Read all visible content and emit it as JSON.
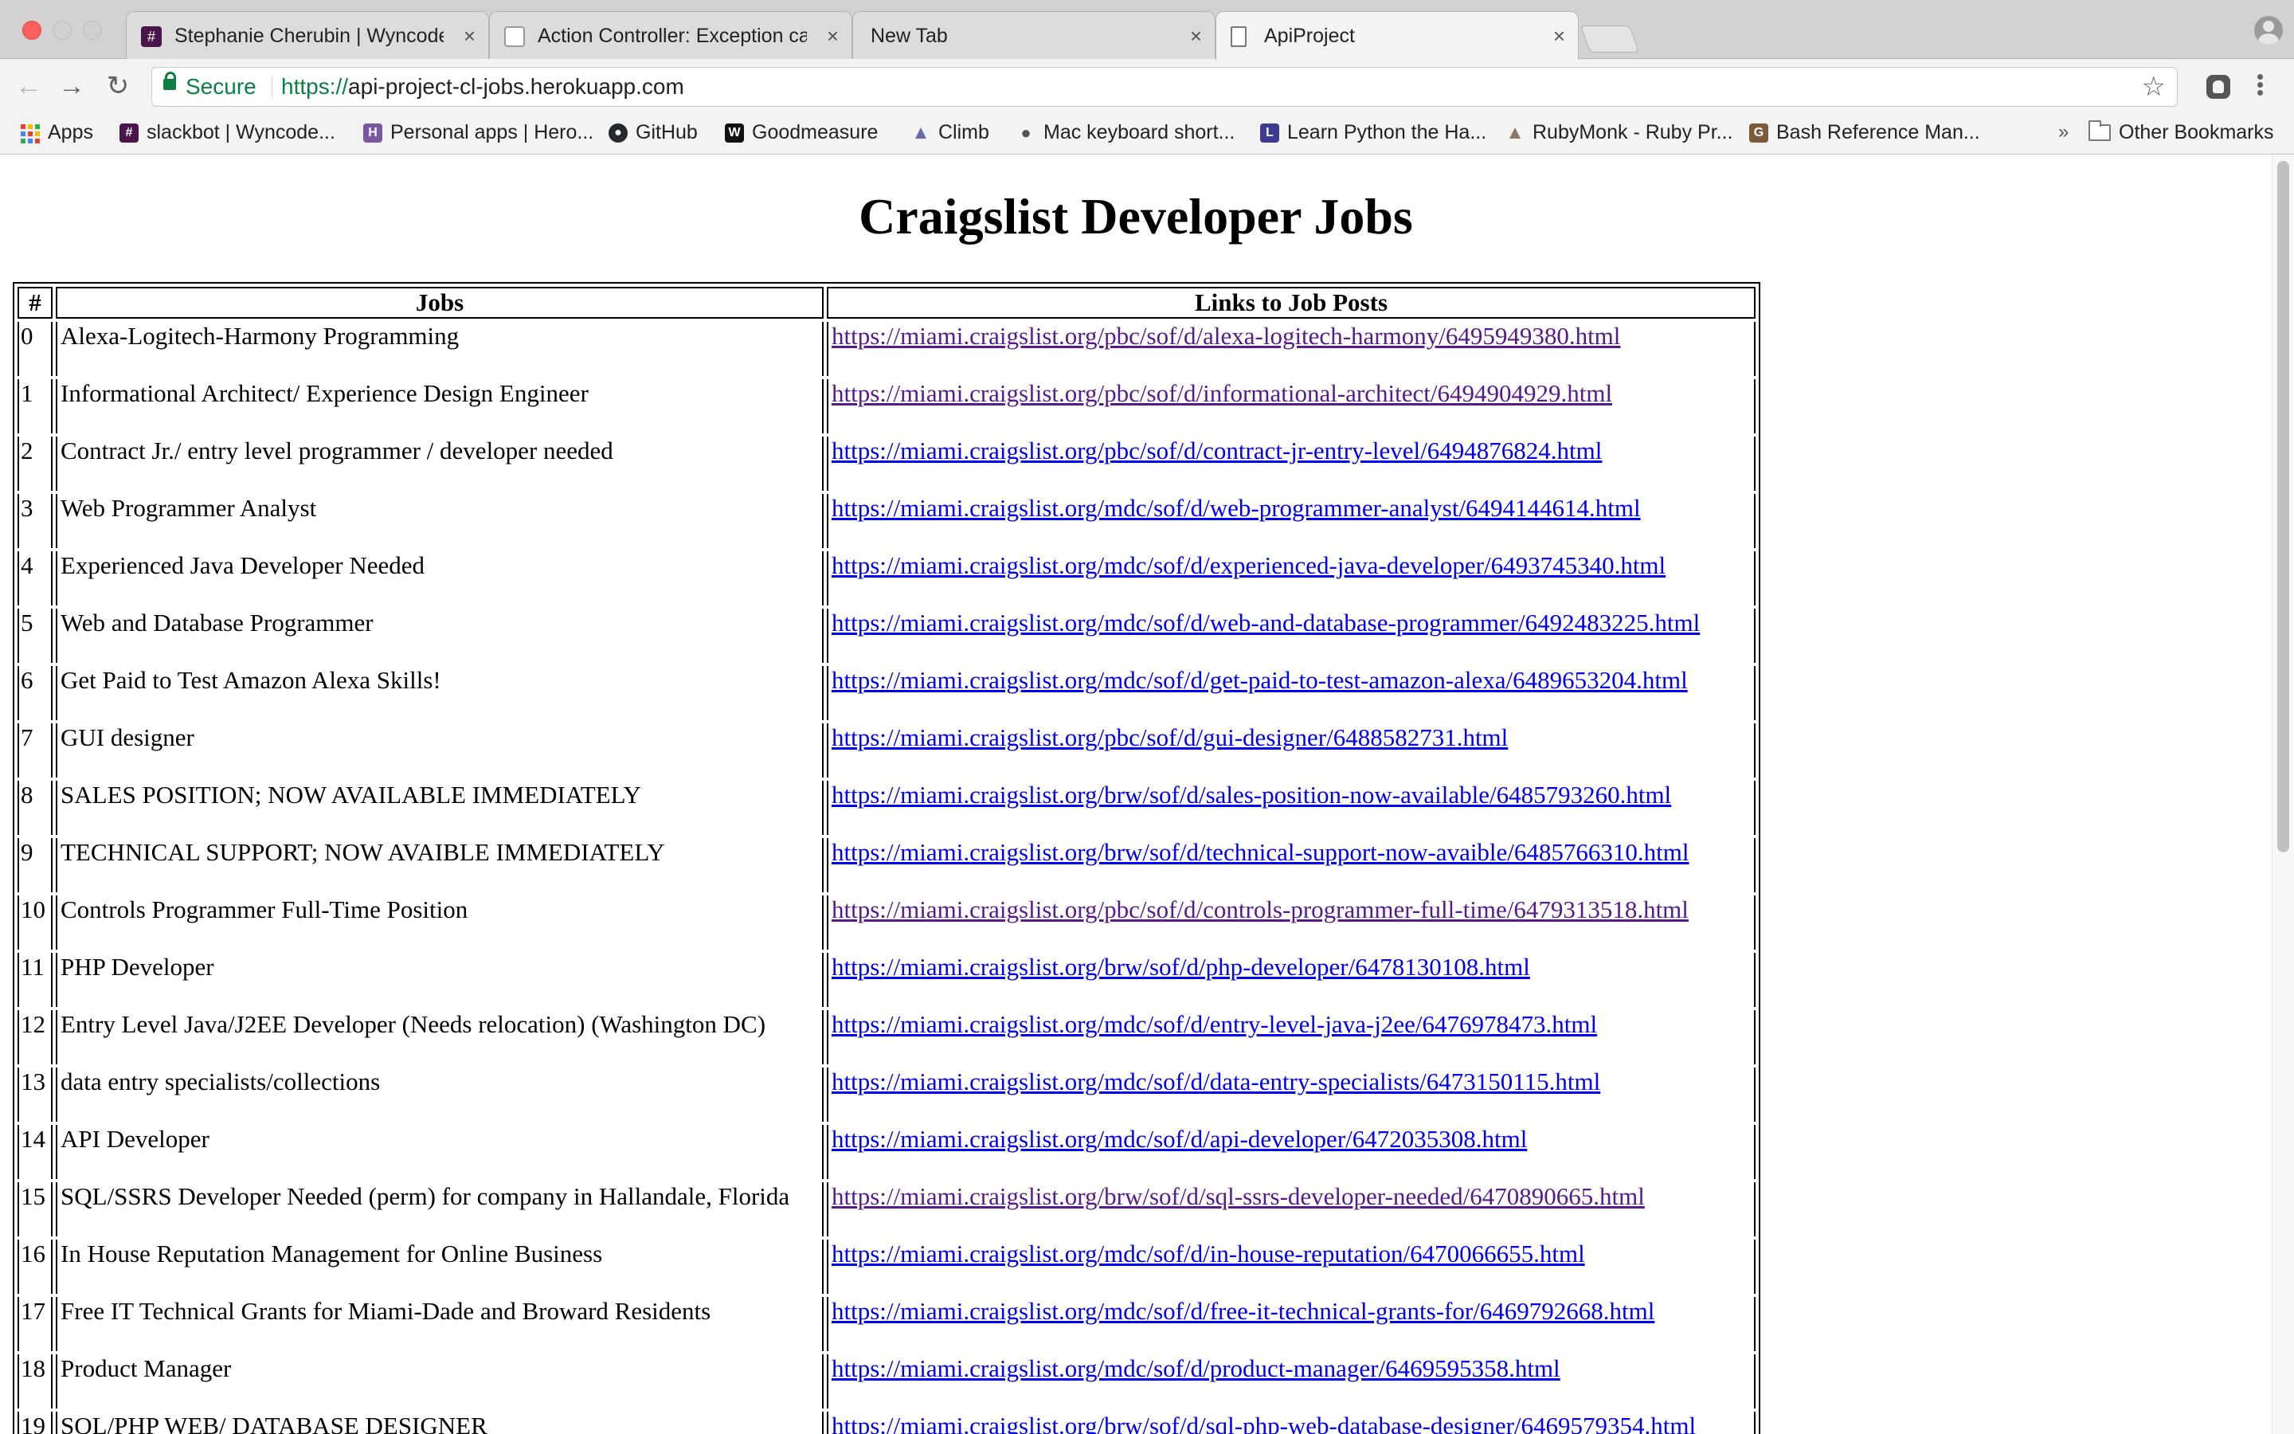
{
  "window": {
    "tabs": [
      {
        "title": "Stephanie Cherubin | Wyncode",
        "favicon_icon": "slack-hash-icon",
        "favicon_color": "#4a154b"
      },
      {
        "title": "Action Controller: Exception ca",
        "favicon_icon": "rails-page-icon",
        "favicon_color": "#9a9a9a"
      },
      {
        "title": "New Tab",
        "favicon_icon": "",
        "favicon_color": ""
      },
      {
        "title": "ApiProject",
        "favicon_icon": "document-icon",
        "favicon_color": "#777777"
      }
    ],
    "active_tab_index": 3,
    "close_glyph": "×"
  },
  "toolbar": {
    "back_glyph": "←",
    "forward_glyph": "→",
    "reload_glyph": "↻",
    "secure_label": "Secure",
    "url_scheme": "https://",
    "url_rest": "api-project-cl-jobs.herokuapp.com",
    "star_glyph": "☆"
  },
  "bookmarks": {
    "items": [
      {
        "label": "Apps",
        "icon": "apps-grid-icon"
      },
      {
        "label": "slackbot | Wyncode...",
        "icon": "slack-hash-icon",
        "color": "#4a154b",
        "glyph": "#"
      },
      {
        "label": "Personal apps | Hero...",
        "icon": "heroku-icon",
        "color": "#79589f",
        "glyph": "H"
      },
      {
        "label": "GitHub",
        "icon": "github-icon",
        "color": "#24292e",
        "glyph": "●"
      },
      {
        "label": "Goodmeasure",
        "icon": "goodmeasure-icon",
        "color": "#111111",
        "glyph": "W"
      },
      {
        "label": "Climb",
        "icon": "climb-mountain-icon",
        "color": "#6b6baa",
        "glyph": "▲"
      },
      {
        "label": "Mac keyboard short...",
        "icon": "apple-icon",
        "color": "#555555",
        "glyph": "●"
      },
      {
        "label": "Learn Python the Ha...",
        "icon": "python-book-icon",
        "color": "#3b3b8f",
        "glyph": "L"
      },
      {
        "label": "RubyMonk - Ruby Pr...",
        "icon": "rubymonk-icon",
        "color": "#8a7b66",
        "glyph": "▲"
      },
      {
        "label": "Bash Reference Man...",
        "icon": "gnu-icon",
        "color": "#7a5c3a",
        "glyph": "G"
      }
    ],
    "overflow_glyph": "»",
    "other_bookmarks_label": "Other Bookmarks"
  },
  "page": {
    "heading": "Craigslist Developer Jobs",
    "table": {
      "headers": [
        "#",
        "Jobs",
        "Links to Job Posts"
      ],
      "rows": [
        {
          "idx": "0",
          "job": "Alexa-Logitech-Harmony Programming",
          "link": "https://miami.craigslist.org/pbc/sof/d/alexa-logitech-harmony/6495949380.html",
          "visited": true
        },
        {
          "idx": "1",
          "job": "Informational Architect/ Experience Design Engineer",
          "link": "https://miami.craigslist.org/pbc/sof/d/informational-architect/6494904929.html",
          "visited": true
        },
        {
          "idx": "2",
          "job": "Contract Jr./ entry level programmer / developer needed",
          "link": "https://miami.craigslist.org/pbc/sof/d/contract-jr-entry-level/6494876824.html",
          "visited": false
        },
        {
          "idx": "3",
          "job": "Web Programmer Analyst",
          "link": "https://miami.craigslist.org/mdc/sof/d/web-programmer-analyst/6494144614.html",
          "visited": false
        },
        {
          "idx": "4",
          "job": "Experienced Java Developer Needed",
          "link": "https://miami.craigslist.org/mdc/sof/d/experienced-java-developer/6493745340.html",
          "visited": false
        },
        {
          "idx": "5",
          "job": "Web and Database Programmer",
          "link": "https://miami.craigslist.org/mdc/sof/d/web-and-database-programmer/6492483225.html",
          "visited": false
        },
        {
          "idx": "6",
          "job": "Get Paid to Test Amazon Alexa Skills!",
          "link": "https://miami.craigslist.org/mdc/sof/d/get-paid-to-test-amazon-alexa/6489653204.html",
          "visited": false
        },
        {
          "idx": "7",
          "job": "GUI designer",
          "link": "https://miami.craigslist.org/pbc/sof/d/gui-designer/6488582731.html",
          "visited": false
        },
        {
          "idx": "8",
          "job": "SALES POSITION; NOW AVAILABLE IMMEDIATELY",
          "link": "https://miami.craigslist.org/brw/sof/d/sales-position-now-available/6485793260.html",
          "visited": false
        },
        {
          "idx": "9",
          "job": "TECHNICAL SUPPORT; NOW AVAIBLE IMMEDIATELY",
          "link": "https://miami.craigslist.org/brw/sof/d/technical-support-now-avaible/6485766310.html",
          "visited": false
        },
        {
          "idx": "10",
          "job": "Controls Programmer Full-Time Position",
          "link": "https://miami.craigslist.org/pbc/sof/d/controls-programmer-full-time/6479313518.html",
          "visited": true
        },
        {
          "idx": "11",
          "job": "PHP Developer",
          "link": "https://miami.craigslist.org/brw/sof/d/php-developer/6478130108.html",
          "visited": false
        },
        {
          "idx": "12",
          "job": "Entry Level Java/J2EE Developer (Needs relocation) (Washington DC)",
          "link": "https://miami.craigslist.org/mdc/sof/d/entry-level-java-j2ee/6476978473.html",
          "visited": false
        },
        {
          "idx": "13",
          "job": "data entry specialists/collections",
          "link": "https://miami.craigslist.org/mdc/sof/d/data-entry-specialists/6473150115.html",
          "visited": false
        },
        {
          "idx": "14",
          "job": "API Developer",
          "link": "https://miami.craigslist.org/mdc/sof/d/api-developer/6472035308.html",
          "visited": false
        },
        {
          "idx": "15",
          "job": "SQL/SSRS Developer Needed (perm) for company in Hallandale, Florida",
          "link": "https://miami.craigslist.org/brw/sof/d/sql-ssrs-developer-needed/6470890665.html",
          "visited": true
        },
        {
          "idx": "16",
          "job": "In House Reputation Management for Online Business",
          "link": "https://miami.craigslist.org/mdc/sof/d/in-house-reputation/6470066655.html",
          "visited": false
        },
        {
          "idx": "17",
          "job": "Free IT Technical Grants for Miami-Dade and Broward Residents",
          "link": "https://miami.craigslist.org/mdc/sof/d/free-it-technical-grants-for/6469792668.html",
          "visited": false
        },
        {
          "idx": "18",
          "job": "Product Manager",
          "link": "https://miami.craigslist.org/mdc/sof/d/product-manager/6469595358.html",
          "visited": false
        },
        {
          "idx": "19",
          "job": "SQL/PHP WEB/ DATABASE DESIGNER",
          "link": "https://miami.craigslist.org/brw/sof/d/sql-php-web-database-designer/6469579354.html",
          "visited": false
        }
      ]
    }
  },
  "colors": {
    "link": "#0000ee",
    "visited_link": "#551a8b",
    "secure_green": "#0b8043",
    "close_red": "#fc605c"
  }
}
